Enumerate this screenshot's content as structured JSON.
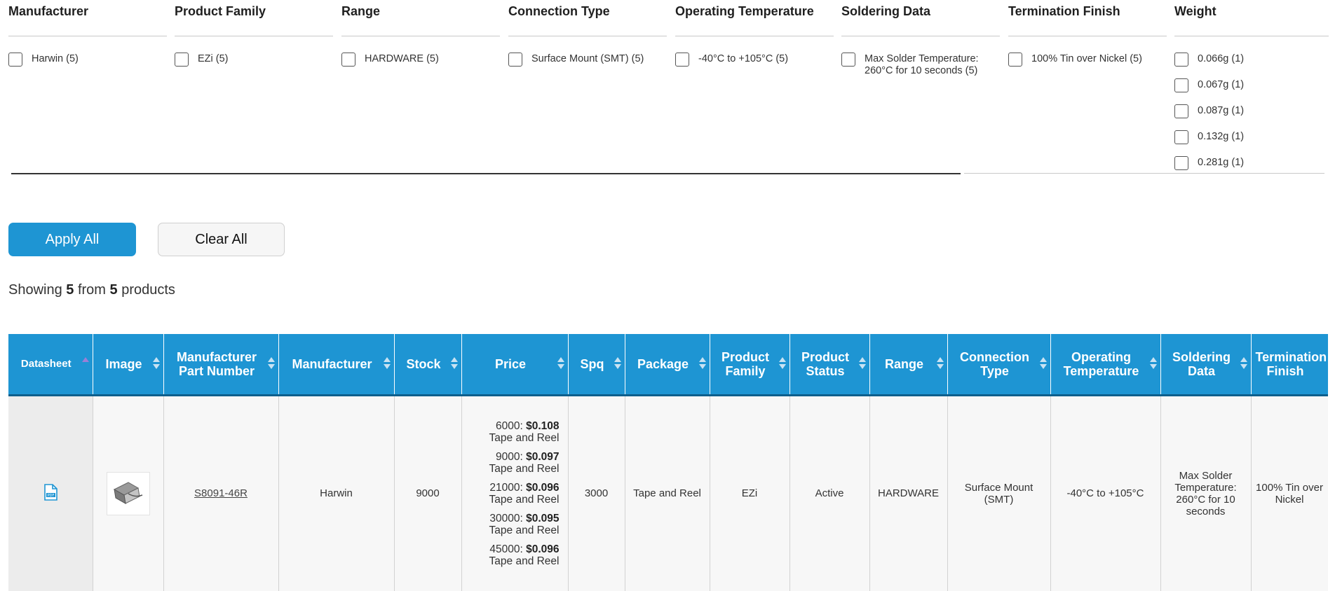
{
  "filters": [
    {
      "title": "Manufacturer",
      "options": [
        "Harwin (5)"
      ]
    },
    {
      "title": "Product Family",
      "options": [
        "EZi (5)"
      ]
    },
    {
      "title": "Range",
      "options": [
        "HARDWARE (5)"
      ]
    },
    {
      "title": "Connection Type",
      "options": [
        "Surface Mount (SMT) (5)"
      ]
    },
    {
      "title": "Operating Temperature",
      "options": [
        "-40°C to +105°C (5)"
      ]
    },
    {
      "title": "Soldering Data",
      "options": [
        "Max Solder Temperature: 260°C for 10 seconds (5)"
      ]
    },
    {
      "title": "Termination Finish",
      "options": [
        "100% Tin over Nickel (5)"
      ]
    },
    {
      "title": "Weight",
      "options": [
        "0.066g (1)",
        "0.067g (1)",
        "0.087g (1)",
        "0.132g (1)",
        "0.281g (1)"
      ]
    }
  ],
  "buttons": {
    "apply": "Apply All",
    "clear": "Clear All"
  },
  "results": {
    "prefix": "Showing",
    "shown": "5",
    "from_word": "from",
    "total": "5",
    "suffix": "products"
  },
  "table": {
    "headers": [
      "Datasheet",
      "Image",
      "Manufacturer Part Number",
      "Manufacturer",
      "Stock",
      "Price",
      "Spq",
      "Package",
      "Product Family",
      "Product Status",
      "Range",
      "Connection Type",
      "Operating Temperature",
      "Soldering Data",
      "Termination Finish"
    ],
    "row": {
      "datasheet_icon": "pdf-icon",
      "image_alt": "part-thumbnail",
      "part_number": "S8091-46R",
      "manufacturer": "Harwin",
      "stock": "9000",
      "prices": [
        {
          "qty": "6000:",
          "price": "$0.108",
          "pack": "Tape and Reel"
        },
        {
          "qty": "9000:",
          "price": "$0.097",
          "pack": "Tape and Reel"
        },
        {
          "qty": "21000:",
          "price": "$0.096",
          "pack": "Tape and Reel"
        },
        {
          "qty": "30000:",
          "price": "$0.095",
          "pack": "Tape and Reel"
        },
        {
          "qty": "45000:",
          "price": "$0.096",
          "pack": "Tape and Reel"
        }
      ],
      "spq": "3000",
      "package": "Tape and Reel",
      "product_family": "EZi",
      "product_status": "Active",
      "range": "HARDWARE",
      "connection_type": "Surface Mount (SMT)",
      "operating_temperature": "-40°C to +105°C",
      "soldering_data": "Max Solder Temperature: 260°C for 10 seconds",
      "termination_finish": "100% Tin over Nickel"
    }
  },
  "colors": {
    "accent": "#1e95d3",
    "sort_active": "#9b7fd6"
  }
}
